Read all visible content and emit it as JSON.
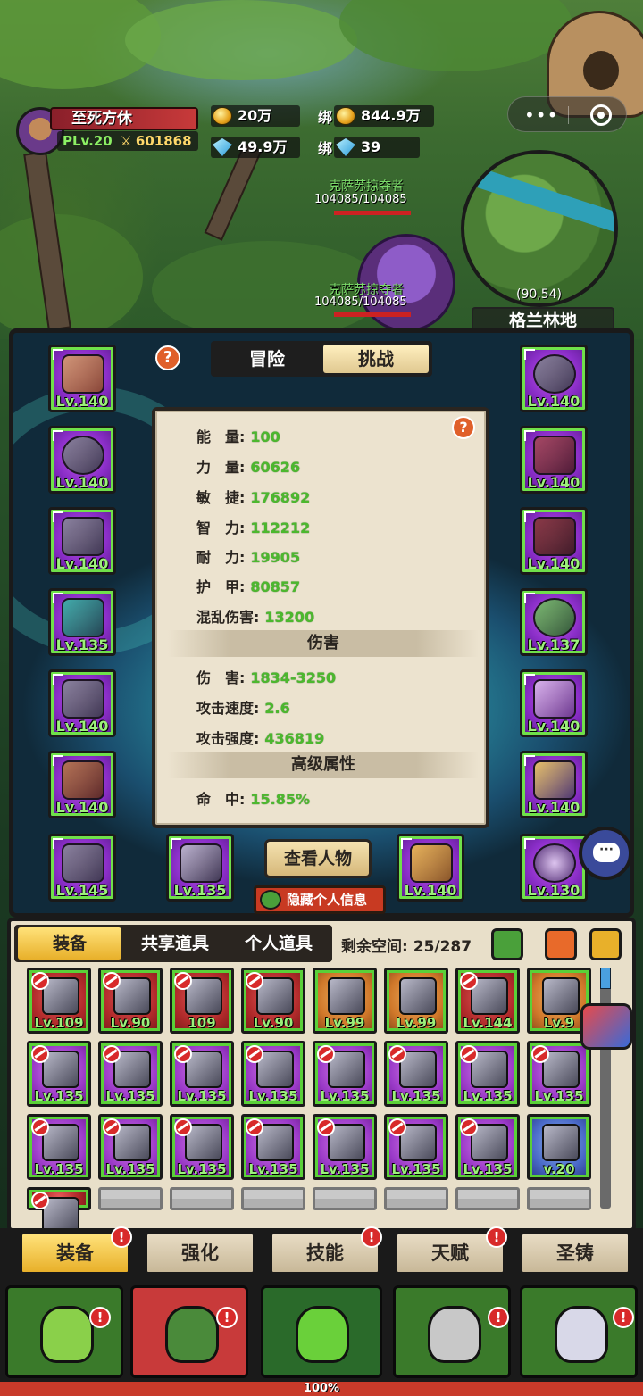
{
  "player": {
    "name": "至死方休",
    "level": "PLv.20",
    "power": "601868"
  },
  "currency": {
    "gold": "20万",
    "bound_gold": "844.9万",
    "diamond": "49.9万",
    "bound_diamond": "39",
    "bind_label": "绑"
  },
  "capsule": {
    "more": "•••"
  },
  "map": {
    "coords": "(90,54)",
    "name": "格兰林地"
  },
  "mobs": [
    {
      "name": "克萨苏掠夺者",
      "hp": "104085/104085"
    },
    {
      "name": "克萨苏掠夺者",
      "hp": "104085/104085"
    },
    {
      "name": "克萨苏掠夺者",
      "hp": "104085/104085"
    }
  ],
  "mode_tabs": {
    "adventure": "冒险",
    "challenge": "挑战"
  },
  "help": "?",
  "equip_left": [
    {
      "level": "Lv.140"
    },
    {
      "level": "Lv.140"
    },
    {
      "level": "Lv.140"
    },
    {
      "level": "Lv.135"
    },
    {
      "level": "Lv.140"
    },
    {
      "level": "Lv.140"
    }
  ],
  "equip_right": [
    {
      "level": "Lv.140"
    },
    {
      "level": "Lv.140"
    },
    {
      "level": "Lv.140"
    },
    {
      "level": "Lv.137"
    },
    {
      "level": "Lv.140"
    },
    {
      "level": "Lv.140"
    }
  ],
  "equip_bottom": [
    {
      "level": "Lv.145"
    },
    {
      "level": "Lv.135"
    },
    {
      "level": "Lv.140"
    },
    {
      "level": "Lv.130"
    }
  ],
  "stats": {
    "energy": {
      "label": "能　量:",
      "value": "100"
    },
    "strength": {
      "label": "力　量:",
      "value": "60626"
    },
    "agility": {
      "label": "敏　捷:",
      "value": "176892"
    },
    "intellect": {
      "label": "智　力:",
      "value": "112212"
    },
    "stamina": {
      "label": "耐　力:",
      "value": "19905"
    },
    "armor": {
      "label": "护　甲:",
      "value": "80857"
    },
    "chaos": {
      "label": "混乱伤害:",
      "value": "13200"
    },
    "damage_header": "伤害",
    "damage": {
      "label": "伤　害:",
      "value": "1834-3250"
    },
    "attack_speed": {
      "label": "攻击速度:",
      "value": "2.6"
    },
    "attack_power": {
      "label": "攻击强度:",
      "value": "436819"
    },
    "advanced_header": "高级属性",
    "hit": {
      "label": "命　中:",
      "value": "15.85%"
    }
  },
  "buttons": {
    "view_character": "查看人物",
    "hide_info": "隐藏个人信息",
    "chat": "···"
  },
  "inventory": {
    "tabs": [
      "装备",
      "共享道具",
      "个人道具"
    ],
    "space_label": "剩余空间:",
    "space_value": "25/287",
    "rows": [
      [
        {
          "c": "red",
          "lv": "Lv.109"
        },
        {
          "c": "red",
          "lv": "Lv.90"
        },
        {
          "c": "red",
          "lv": "109"
        },
        {
          "c": "red",
          "lv": "Lv.90"
        },
        {
          "c": "orange",
          "lv": "Lv.99"
        },
        {
          "c": "orange",
          "lv": "Lv.99"
        },
        {
          "c": "red",
          "lv": "Lv.144"
        },
        {
          "c": "orange",
          "lv": "Lv.9"
        }
      ],
      [
        {
          "c": "purple",
          "lv": "Lv.135"
        },
        {
          "c": "purple",
          "lv": "Lv.135"
        },
        {
          "c": "purple",
          "lv": "Lv.135"
        },
        {
          "c": "purple",
          "lv": "Lv.135"
        },
        {
          "c": "purple",
          "lv": "Lv.135"
        },
        {
          "c": "purple",
          "lv": "Lv.135"
        },
        {
          "c": "purple",
          "lv": "Lv.135"
        },
        {
          "c": "purple",
          "lv": "Lv.135"
        }
      ],
      [
        {
          "c": "purple",
          "lv": "Lv.135"
        },
        {
          "c": "purple",
          "lv": "Lv.135"
        },
        {
          "c": "purple",
          "lv": "Lv.135"
        },
        {
          "c": "purple",
          "lv": "Lv.135"
        },
        {
          "c": "purple",
          "lv": "Lv.135"
        },
        {
          "c": "purple",
          "lv": "Lv.135"
        },
        {
          "c": "purple",
          "lv": "Lv.135"
        },
        {
          "c": "blue",
          "lv": "v.20"
        }
      ],
      [
        {
          "c": "red",
          "lv": ""
        },
        {
          "c": "empty",
          "lv": ""
        },
        {
          "c": "empty",
          "lv": ""
        },
        {
          "c": "empty",
          "lv": ""
        },
        {
          "c": "empty",
          "lv": ""
        },
        {
          "c": "empty",
          "lv": ""
        },
        {
          "c": "empty",
          "lv": ""
        },
        {
          "c": "empty",
          "lv": ""
        }
      ]
    ]
  },
  "subnav": [
    "装备",
    "强化",
    "技能",
    "天赋",
    "圣铸"
  ],
  "badge": "!",
  "progress": "100%",
  "colors": {
    "accent_green": "#4cb82e",
    "alert_red": "#d82a2a",
    "gold": "#e8b02a"
  }
}
